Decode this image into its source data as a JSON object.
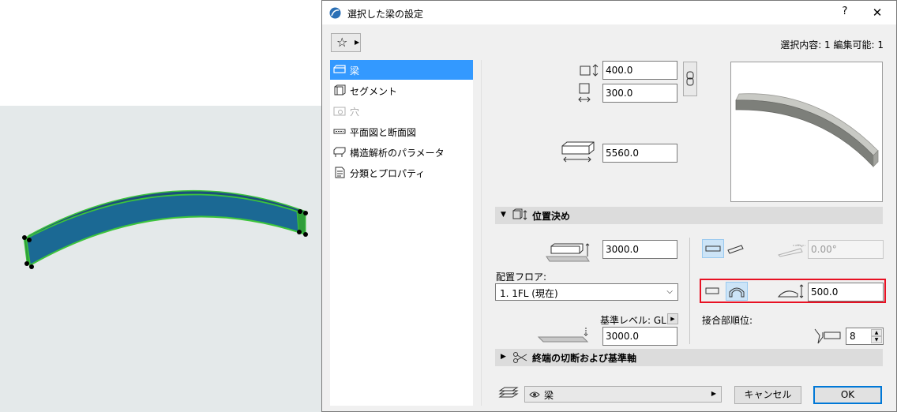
{
  "dialog": {
    "title": "選択した梁の設定",
    "help_label": "?",
    "close_label": "✕",
    "selection_info": "選択内容: 1 編集可能: 1"
  },
  "nav": {
    "items": [
      {
        "label": "梁",
        "icon": "beam-icon",
        "state": "active"
      },
      {
        "label": "セグメント",
        "icon": "segment-icon",
        "state": "normal"
      },
      {
        "label": "穴",
        "icon": "hole-icon",
        "state": "disabled"
      },
      {
        "label": "平面図と断面図",
        "icon": "floorplan-section-icon",
        "state": "normal"
      },
      {
        "label": "構造解析のパラメータ",
        "icon": "structural-analysis-icon",
        "state": "normal"
      },
      {
        "label": "分類とプロパティ",
        "icon": "classification-icon",
        "state": "normal"
      }
    ]
  },
  "beam": {
    "width": "400.0",
    "height": "300.0",
    "length": "5560.0"
  },
  "positioning": {
    "section_label": "位置決め",
    "ref_offset": "3000.0",
    "home_floor_label": "配置フロア:",
    "home_floor_value": "1. 1FL (現在)",
    "ref_level_label": "基準レベル: GL",
    "ref_level_value": "3000.0",
    "tilt_angle": "0.00°",
    "curve_rise": "500.0",
    "priority_label": "接合部順位:",
    "priority_value": "8"
  },
  "end_cuts": {
    "section_label": "終端の切断および基準軸"
  },
  "footer": {
    "layer_value": "梁",
    "cancel_label": "キャンセル",
    "ok_label": "OK"
  },
  "colors": {
    "accent": "#3399ff",
    "highlight_border": "#e81123",
    "beam_top": "#1a5c8c",
    "beam_outline": "#3cc43c"
  }
}
